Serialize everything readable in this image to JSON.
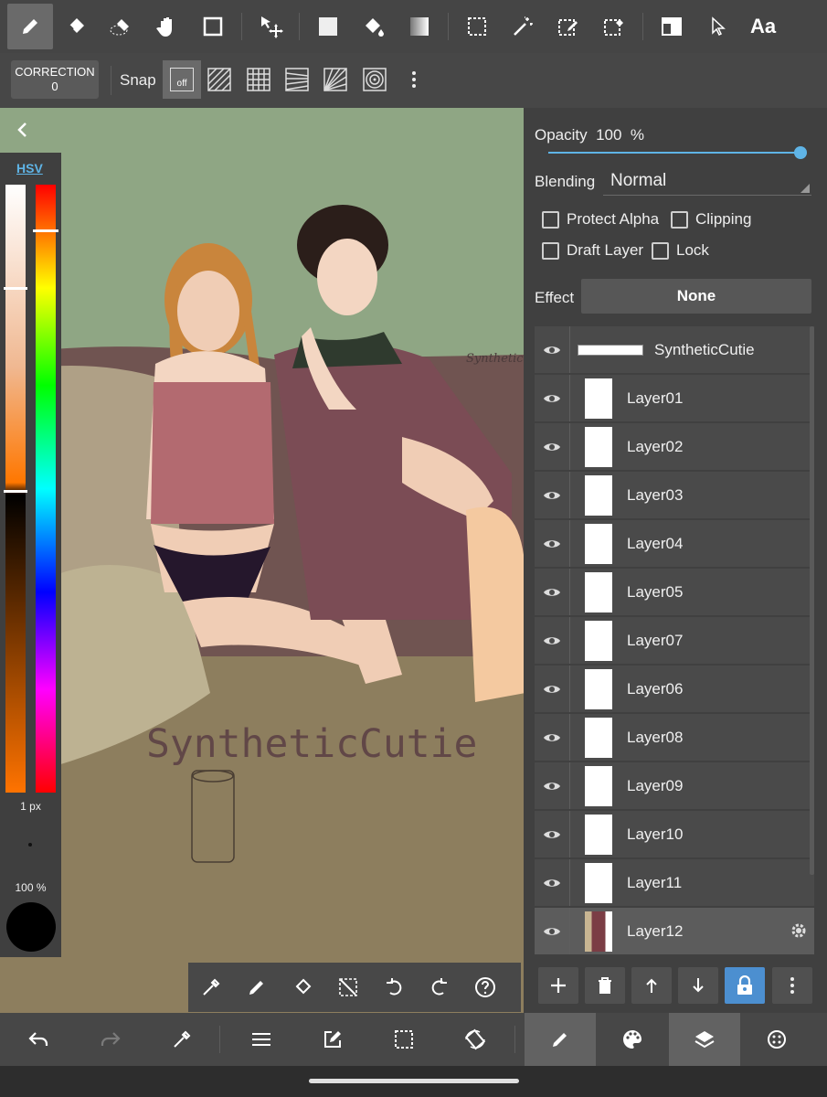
{
  "correction": {
    "label": "CORRECTION",
    "value": "0"
  },
  "snap": {
    "label": "Snap",
    "off_label": "off"
  },
  "toolbar": {
    "text_tool_label": "Aa"
  },
  "color_panel": {
    "mode_label": "HSV",
    "brush_size": "1 px",
    "brush_opacity": "100 %",
    "current_color": "#000000"
  },
  "properties": {
    "opacity_label": "Opacity",
    "opacity_value": "100",
    "opacity_unit": "%",
    "blending_label": "Blending",
    "blending_value": "Normal",
    "protect_alpha": "Protect Alpha",
    "clipping": "Clipping",
    "draft_layer": "Draft Layer",
    "lock": "Lock",
    "effect_label": "Effect",
    "effect_value": "None"
  },
  "layers": [
    {
      "name": "SyntheticCutie"
    },
    {
      "name": "Layer01"
    },
    {
      "name": "Layer02"
    },
    {
      "name": "Layer03"
    },
    {
      "name": "Layer04"
    },
    {
      "name": "Layer05"
    },
    {
      "name": "Layer07"
    },
    {
      "name": "Layer06"
    },
    {
      "name": "Layer08"
    },
    {
      "name": "Layer09"
    },
    {
      "name": "Layer10"
    },
    {
      "name": "Layer11"
    },
    {
      "name": "Layer12"
    }
  ],
  "canvas": {
    "watermark": "SyntheticCutie",
    "signature": "SyntheticCutie"
  },
  "colors": {
    "accent": "#5fb4e6",
    "panel": "#404040",
    "toolbar": "#454545"
  }
}
